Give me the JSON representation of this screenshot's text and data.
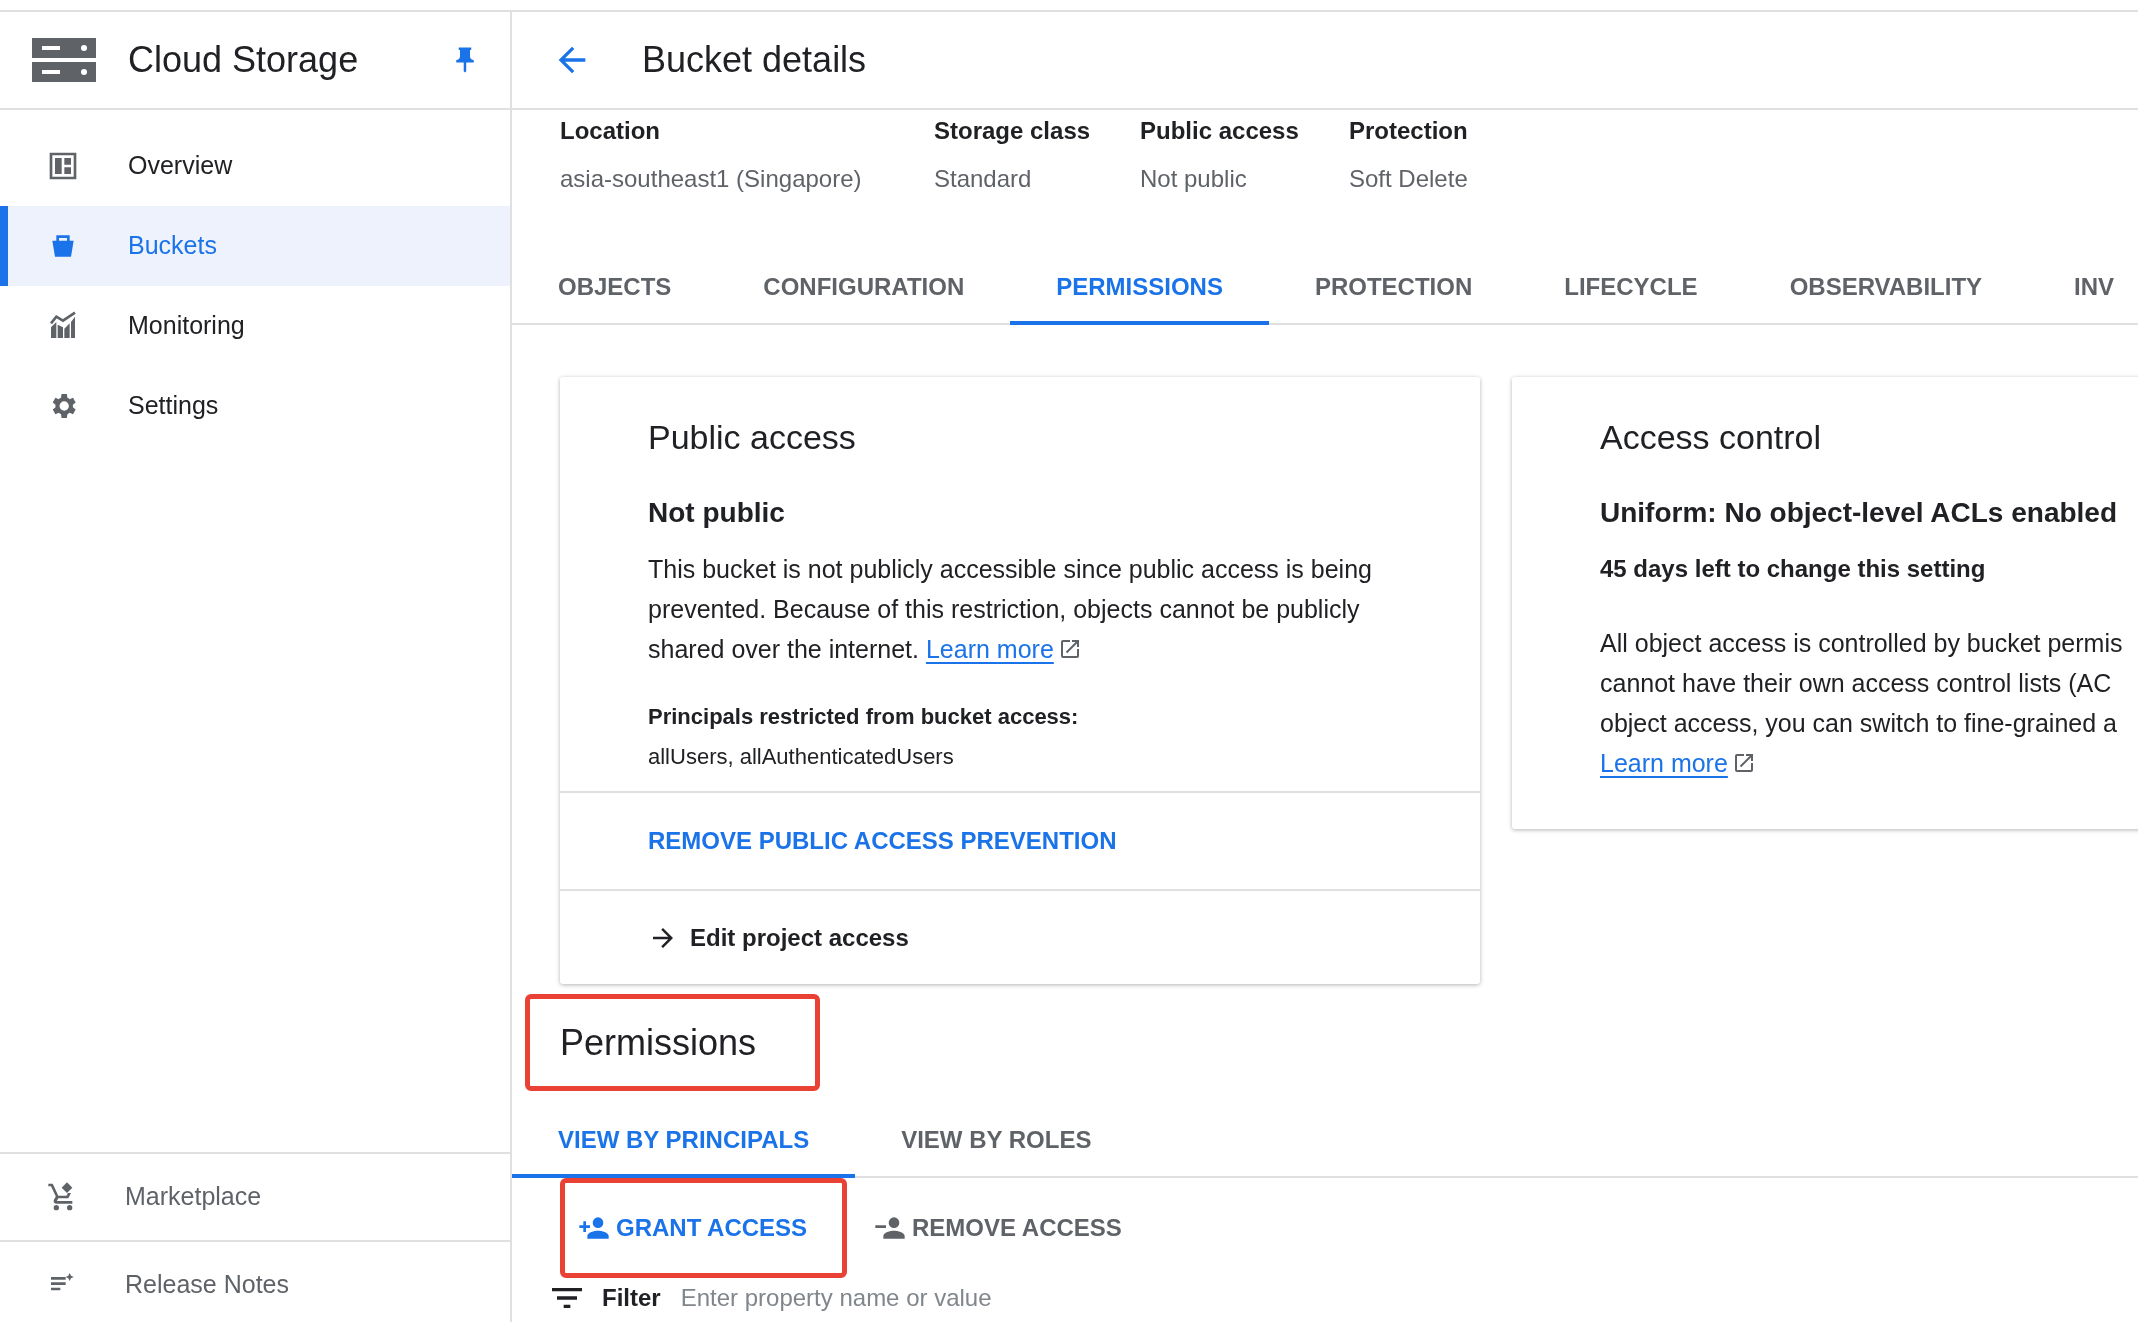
{
  "sidebar": {
    "title": "Cloud Storage",
    "items": [
      {
        "label": "Overview",
        "selected": false
      },
      {
        "label": "Buckets",
        "selected": true
      },
      {
        "label": "Monitoring",
        "selected": false
      },
      {
        "label": "Settings",
        "selected": false
      }
    ],
    "footer_items": [
      {
        "label": "Marketplace"
      },
      {
        "label": "Release Notes"
      }
    ]
  },
  "header": {
    "title": "Bucket details"
  },
  "summary": [
    {
      "label": "Location",
      "value": "asia-southeast1 (Singapore)"
    },
    {
      "label": "Storage class",
      "value": "Standard"
    },
    {
      "label": "Public access",
      "value": "Not public"
    },
    {
      "label": "Protection",
      "value": "Soft Delete"
    }
  ],
  "tabs": [
    {
      "label": "OBJECTS",
      "selected": false
    },
    {
      "label": "CONFIGURATION",
      "selected": false
    },
    {
      "label": "PERMISSIONS",
      "selected": true
    },
    {
      "label": "PROTECTION",
      "selected": false
    },
    {
      "label": "LIFECYCLE",
      "selected": false
    },
    {
      "label": "OBSERVABILITY",
      "selected": false
    },
    {
      "label": "INV",
      "selected": false
    }
  ],
  "public_access_card": {
    "title": "Public access",
    "status": "Not public",
    "description": "This bucket is not publicly accessible since public access is being prevented. Because of this restriction, objects cannot be publicly shared over the internet.",
    "link": "Learn more",
    "principals_label": "Principals restricted from bucket access:",
    "principals": "allUsers, allAuthenticatedUsers",
    "action": "REMOVE PUBLIC ACCESS PREVENTION",
    "edit_link": "Edit project access"
  },
  "access_control_card": {
    "title": "Access control",
    "mode": "Uniform: No object-level ACLs enabled",
    "notice": "45 days left to change this setting",
    "description_lines": [
      "All object access is controlled by bucket permis",
      "cannot have their own access control lists (AC",
      "object access, you can switch to fine-grained a"
    ],
    "link": "Learn more"
  },
  "permissions": {
    "title": "Permissions",
    "highlighted": true,
    "tabs": [
      {
        "label": "VIEW BY PRINCIPALS",
        "selected": true
      },
      {
        "label": "VIEW BY ROLES",
        "selected": false
      }
    ],
    "actions": [
      {
        "label": "GRANT ACCESS",
        "highlighted": true,
        "disabled": false
      },
      {
        "label": "REMOVE ACCESS",
        "highlighted": false,
        "disabled": true
      }
    ],
    "filter": {
      "label": "Filter",
      "placeholder": "Enter property name or value"
    }
  }
}
